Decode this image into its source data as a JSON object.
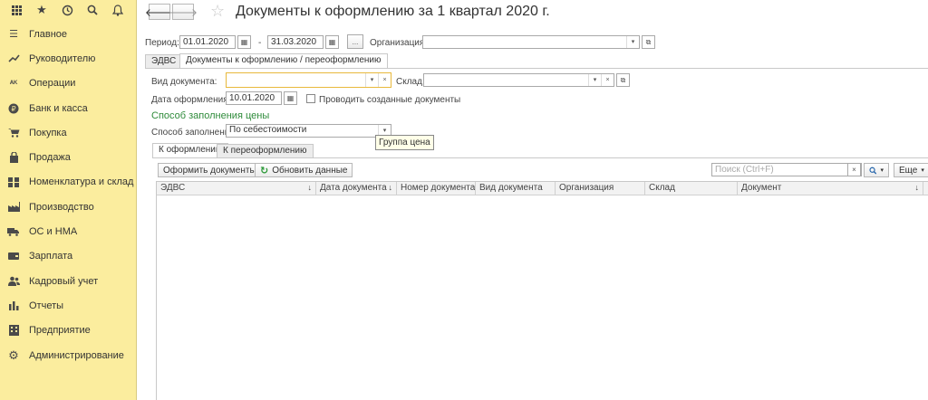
{
  "sidebar": {
    "items": [
      {
        "label": "Главное",
        "icon": "menu-lines-icon"
      },
      {
        "label": "Руководителю",
        "icon": "trend-icon"
      },
      {
        "label": "Операции",
        "icon": "dt-kt-icon"
      },
      {
        "label": "Банк и касса",
        "icon": "coin-icon"
      },
      {
        "label": "Покупка",
        "icon": "cart-icon"
      },
      {
        "label": "Продажа",
        "icon": "bag-icon"
      },
      {
        "label": "Номенклатура и склад",
        "icon": "grid-icon"
      },
      {
        "label": "Производство",
        "icon": "factory-icon"
      },
      {
        "label": "ОС и НМА",
        "icon": "truck-icon"
      },
      {
        "label": "Зарплата",
        "icon": "wallet-icon"
      },
      {
        "label": "Кадровый учет",
        "icon": "people-icon"
      },
      {
        "label": "Отчеты",
        "icon": "bar-chart-icon"
      },
      {
        "label": "Предприятие",
        "icon": "building-icon"
      },
      {
        "label": "Администрирование",
        "icon": "gear-icon"
      }
    ]
  },
  "header": {
    "title": "Документы к оформлению  за 1 квартал 2020 г."
  },
  "filters": {
    "period_label": "Период:",
    "period_from": "01.01.2020",
    "period_dash": "-",
    "period_to": "31.03.2020",
    "more_label": "...",
    "org_label": "Организация:",
    "org_value": ""
  },
  "top_tabs": [
    {
      "label": "ЭДВС"
    },
    {
      "label": "Документы к оформлению / переоформлению"
    }
  ],
  "form": {
    "doc_type_label": "Вид документа:",
    "doc_type_value": "",
    "warehouse_label": "Склад:",
    "warehouse_value": "",
    "date_label": "Дата оформления:",
    "date_value": "10.01.2020",
    "post_label": "Проводить созданные документы",
    "price_section": "Способ заполнения цены",
    "fill_label": "Способ заполнения:",
    "fill_value": "По себестоимости",
    "tooltip": "Группа цена"
  },
  "inner_tabs": [
    {
      "label": "К оформлению"
    },
    {
      "label": "К переоформлению"
    }
  ],
  "toolbar": {
    "create_label": "Оформить документы",
    "refresh_label": "Обновить данные",
    "search_placeholder": "Поиск (Ctrl+F)",
    "more_label": "Еще"
  },
  "table": {
    "columns": [
      "ЭДВС",
      "Дата документа",
      "Номер документа",
      "Вид документа",
      "Организация",
      "Склад",
      "Документ"
    ]
  }
}
